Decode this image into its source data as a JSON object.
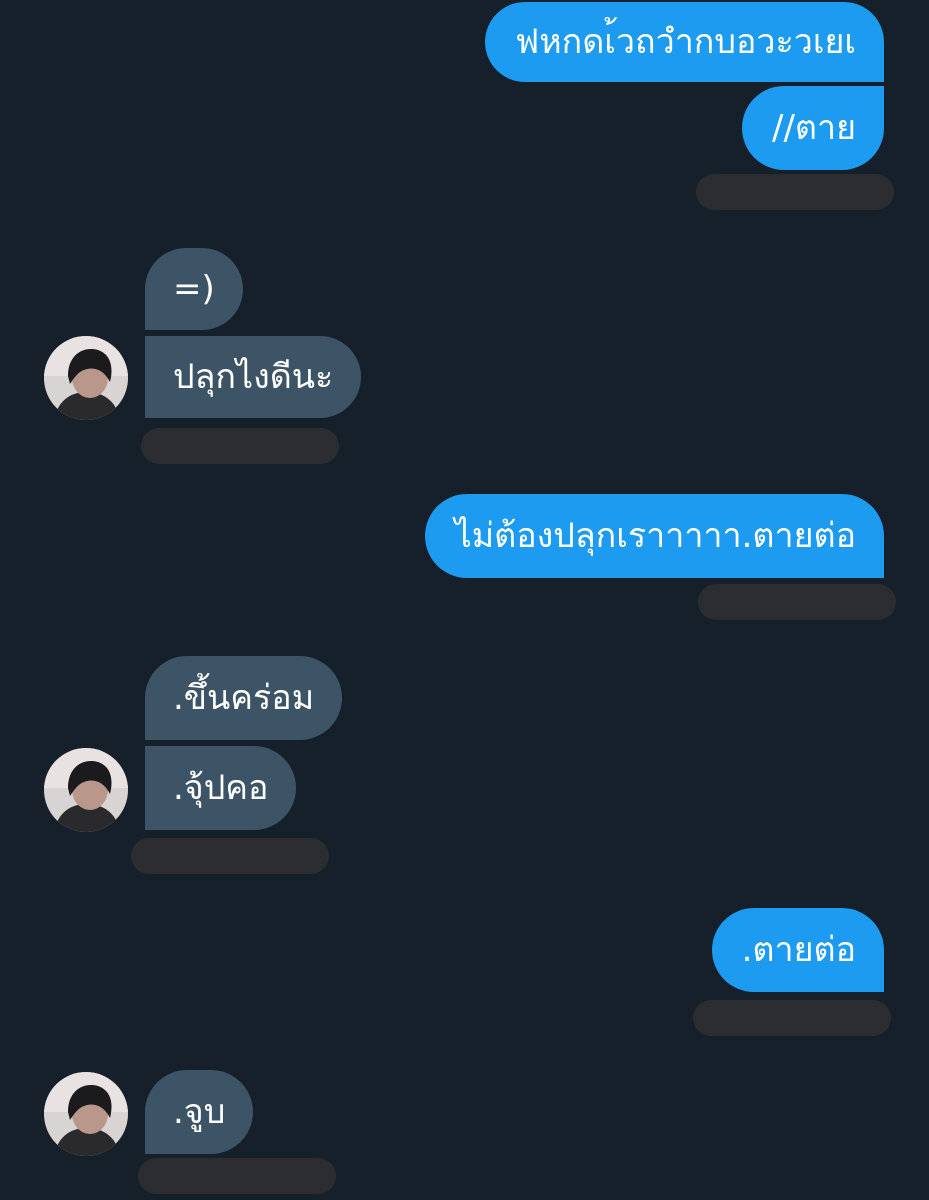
{
  "messages": {
    "m1": "ฟหกดเ้วถวำกบอวะวเยเ",
    "m2": "//ตาย",
    "m3": "=)",
    "m4": "ปลุกไงดีนะ",
    "m5": "ไม่ต้องปลุกเราาาาา.ตายต่อ",
    "m6": ".ขึ้นคร่อม",
    "m7": ".จุ้ปคอ",
    "m8": ".ตายต่อ",
    "m9": ".จูบ"
  },
  "colors": {
    "background": "#16202b",
    "outgoing_bubble": "#1d9bf0",
    "incoming_bubble": "#3d5466",
    "redacted_timestamp": "#2b2d30"
  },
  "icons": {
    "avatar": "profile-photo-avatar"
  }
}
